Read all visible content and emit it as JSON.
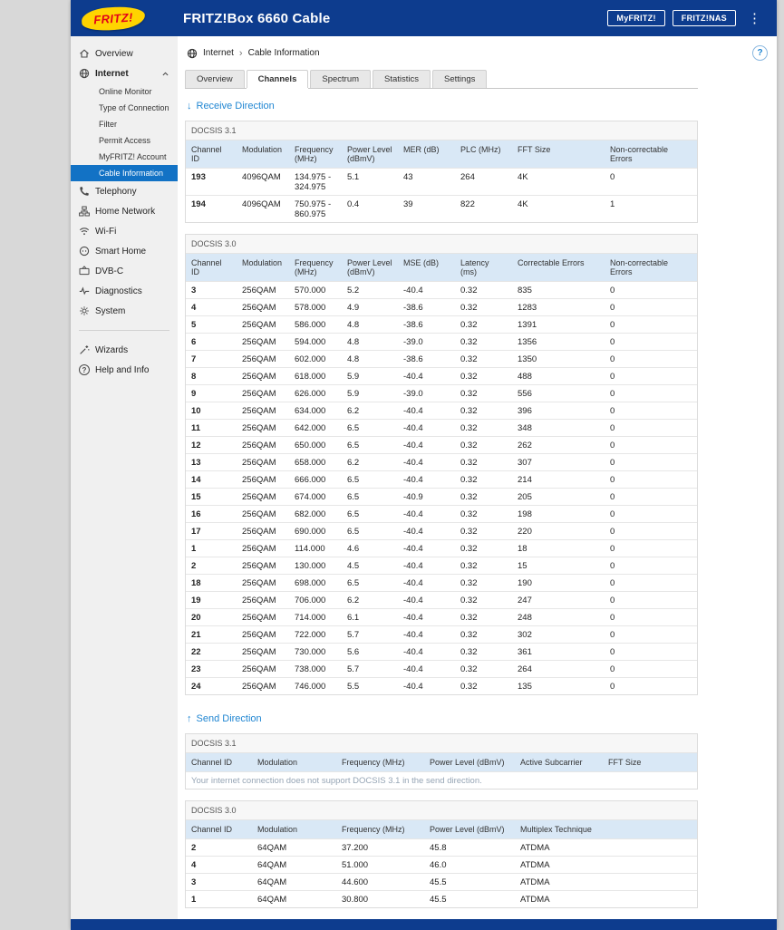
{
  "colors": {
    "header_bg": "#0d3c8e",
    "accent_blue": "#2086d2",
    "active_nav_bg": "#1272c5",
    "table_header_bg": "#d9e8f6",
    "logo_yellow": "#ffd400",
    "logo_red": "#e2001a"
  },
  "header": {
    "logo_text": "FRITZ!",
    "title": "FRITZ!Box 6660 Cable",
    "myfritz_button": "MyFRITZ!",
    "fritznas_button": "FRITZ!NAS",
    "menu_glyph": "⋮"
  },
  "sidebar": {
    "items": [
      {
        "label": "Overview",
        "icon": "home-icon"
      },
      {
        "label": "Internet",
        "icon": "globe-icon"
      },
      {
        "label": "Telephony",
        "icon": "phone-icon"
      },
      {
        "label": "Home Network",
        "icon": "network-icon"
      },
      {
        "label": "Wi-Fi",
        "icon": "wifi-icon"
      },
      {
        "label": "Smart Home",
        "icon": "outlet-icon"
      },
      {
        "label": "DVB-C",
        "icon": "tv-icon"
      },
      {
        "label": "Diagnostics",
        "icon": "pulse-icon"
      },
      {
        "label": "System",
        "icon": "gear-icon"
      }
    ],
    "internet_submenu": [
      {
        "label": "Online Monitor",
        "active": false
      },
      {
        "label": "Type of Connection",
        "active": false
      },
      {
        "label": "Filter",
        "active": false
      },
      {
        "label": "Permit Access",
        "active": false
      },
      {
        "label": "MyFRITZ! Account",
        "active": false
      },
      {
        "label": "Cable Information",
        "active": true
      }
    ],
    "bottom_items": [
      {
        "label": "Wizards",
        "icon": "wand-icon"
      },
      {
        "label": "Help and Info",
        "icon": "question-circle-icon"
      }
    ],
    "help_glyph": "?"
  },
  "breadcrumb": {
    "level1": "Internet",
    "separator": "›",
    "level2": "Cable Information",
    "help_label": "?"
  },
  "tabs": [
    {
      "label": "Overview",
      "active": false
    },
    {
      "label": "Channels",
      "active": true
    },
    {
      "label": "Spectrum",
      "active": false
    },
    {
      "label": "Statistics",
      "active": false
    },
    {
      "label": "Settings",
      "active": false
    }
  ],
  "receive": {
    "arrow": "↓",
    "heading": "Receive Direction",
    "docsis31": {
      "title": "DOCSIS 3.1",
      "columns": [
        "Channel ID",
        "Modulation",
        "Frequency (MHz)",
        "Power Level (dBmV)",
        "MER (dB)",
        "PLC (MHz)",
        "FFT Size",
        "Non-correctable Errors"
      ],
      "rows": [
        [
          "193",
          "4096QAM",
          "134.975 - 324.975",
          "5.1",
          "43",
          "264",
          "4K",
          "0"
        ],
        [
          "194",
          "4096QAM",
          "750.975 - 860.975",
          "0.4",
          "39",
          "822",
          "4K",
          "1"
        ]
      ]
    },
    "docsis30": {
      "title": "DOCSIS 3.0",
      "columns": [
        "Channel ID",
        "Modulation",
        "Frequency (MHz)",
        "Power Level (dBmV)",
        "MSE (dB)",
        "Latency (ms)",
        "Correctable Errors",
        "Non-correctable Errors"
      ],
      "rows": [
        [
          "3",
          "256QAM",
          "570.000",
          "5.2",
          "-40.4",
          "0.32",
          "835",
          "0"
        ],
        [
          "4",
          "256QAM",
          "578.000",
          "4.9",
          "-38.6",
          "0.32",
          "1283",
          "0"
        ],
        [
          "5",
          "256QAM",
          "586.000",
          "4.8",
          "-38.6",
          "0.32",
          "1391",
          "0"
        ],
        [
          "6",
          "256QAM",
          "594.000",
          "4.8",
          "-39.0",
          "0.32",
          "1356",
          "0"
        ],
        [
          "7",
          "256QAM",
          "602.000",
          "4.8",
          "-38.6",
          "0.32",
          "1350",
          "0"
        ],
        [
          "8",
          "256QAM",
          "618.000",
          "5.9",
          "-40.4",
          "0.32",
          "488",
          "0"
        ],
        [
          "9",
          "256QAM",
          "626.000",
          "5.9",
          "-39.0",
          "0.32",
          "556",
          "0"
        ],
        [
          "10",
          "256QAM",
          "634.000",
          "6.2",
          "-40.4",
          "0.32",
          "396",
          "0"
        ],
        [
          "11",
          "256QAM",
          "642.000",
          "6.5",
          "-40.4",
          "0.32",
          "348",
          "0"
        ],
        [
          "12",
          "256QAM",
          "650.000",
          "6.5",
          "-40.4",
          "0.32",
          "262",
          "0"
        ],
        [
          "13",
          "256QAM",
          "658.000",
          "6.2",
          "-40.4",
          "0.32",
          "307",
          "0"
        ],
        [
          "14",
          "256QAM",
          "666.000",
          "6.5",
          "-40.4",
          "0.32",
          "214",
          "0"
        ],
        [
          "15",
          "256QAM",
          "674.000",
          "6.5",
          "-40.9",
          "0.32",
          "205",
          "0"
        ],
        [
          "16",
          "256QAM",
          "682.000",
          "6.5",
          "-40.4",
          "0.32",
          "198",
          "0"
        ],
        [
          "17",
          "256QAM",
          "690.000",
          "6.5",
          "-40.4",
          "0.32",
          "220",
          "0"
        ],
        [
          "1",
          "256QAM",
          "114.000",
          "4.6",
          "-40.4",
          "0.32",
          "18",
          "0"
        ],
        [
          "2",
          "256QAM",
          "130.000",
          "4.5",
          "-40.4",
          "0.32",
          "15",
          "0"
        ],
        [
          "18",
          "256QAM",
          "698.000",
          "6.5",
          "-40.4",
          "0.32",
          "190",
          "0"
        ],
        [
          "19",
          "256QAM",
          "706.000",
          "6.2",
          "-40.4",
          "0.32",
          "247",
          "0"
        ],
        [
          "20",
          "256QAM",
          "714.000",
          "6.1",
          "-40.4",
          "0.32",
          "248",
          "0"
        ],
        [
          "21",
          "256QAM",
          "722.000",
          "5.7",
          "-40.4",
          "0.32",
          "302",
          "0"
        ],
        [
          "22",
          "256QAM",
          "730.000",
          "5.6",
          "-40.4",
          "0.32",
          "361",
          "0"
        ],
        [
          "23",
          "256QAM",
          "738.000",
          "5.7",
          "-40.4",
          "0.32",
          "264",
          "0"
        ],
        [
          "24",
          "256QAM",
          "746.000",
          "5.5",
          "-40.4",
          "0.32",
          "135",
          "0"
        ]
      ]
    }
  },
  "send": {
    "arrow": "↑",
    "heading": "Send Direction",
    "docsis31": {
      "title": "DOCSIS 3.1",
      "columns": [
        "Channel ID",
        "Modulation",
        "Frequency (MHz)",
        "Power Level (dBmV)",
        "Active Subcarrier",
        "FFT Size"
      ],
      "rows": [],
      "empty_message": "Your internet connection does not support DOCSIS 3.1 in the send direction."
    },
    "docsis30": {
      "title": "DOCSIS 3.0",
      "columns": [
        "Channel ID",
        "Modulation",
        "Frequency (MHz)",
        "Power Level (dBmV)",
        "Multiplex Technique"
      ],
      "rows": [
        [
          "2",
          "64QAM",
          "37.200",
          "45.8",
          "ATDMA"
        ],
        [
          "4",
          "64QAM",
          "51.000",
          "46.0",
          "ATDMA"
        ],
        [
          "3",
          "64QAM",
          "44.600",
          "45.5",
          "ATDMA"
        ],
        [
          "1",
          "64QAM",
          "30.800",
          "45.5",
          "ATDMA"
        ]
      ]
    }
  }
}
